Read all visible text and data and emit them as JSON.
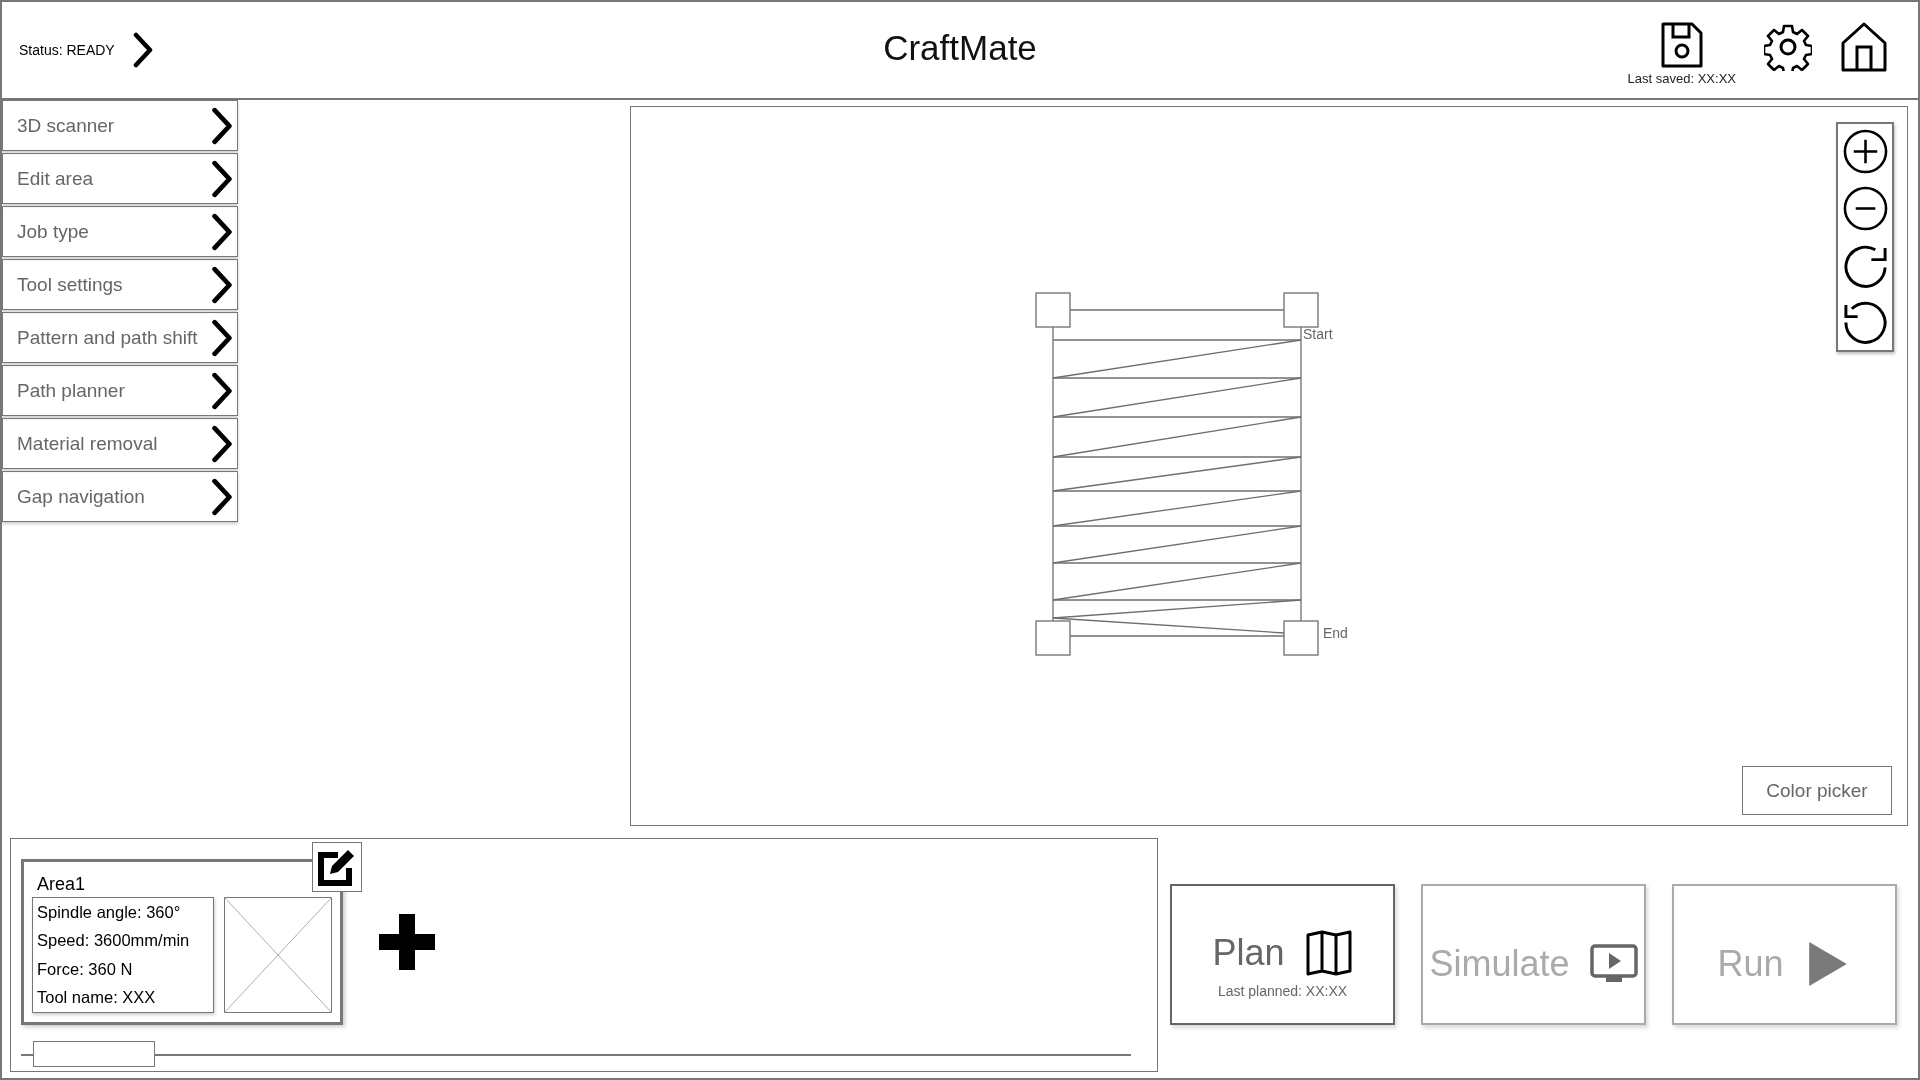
{
  "header": {
    "status": "Status: READY",
    "title": "CraftMate",
    "last_saved": "Last saved: XX:XX"
  },
  "sidebar": {
    "items": [
      {
        "label": "3D scanner"
      },
      {
        "label": "Edit area"
      },
      {
        "label": "Job type"
      },
      {
        "label": "Tool settings"
      },
      {
        "label": "Pattern and path shift"
      },
      {
        "label": "Path planner"
      },
      {
        "label": "Material removal"
      },
      {
        "label": "Gap navigation"
      }
    ]
  },
  "canvas": {
    "start_label": "Start",
    "end_label": "End",
    "color_picker": "Color picker"
  },
  "areas": [
    {
      "title": "Area1",
      "details": [
        "Spindle angle: 360°",
        "Speed: 3600mm/min",
        "Force: 360 N",
        "Tool name: XXX"
      ]
    }
  ],
  "actions": [
    {
      "kind": "plan",
      "label": "Plan",
      "caption": "Last planned: XX:XX",
      "disabled": false
    },
    {
      "kind": "simulate",
      "label": "Simulate",
      "disabled": true
    },
    {
      "kind": "run",
      "label": "Run",
      "disabled": true
    }
  ]
}
